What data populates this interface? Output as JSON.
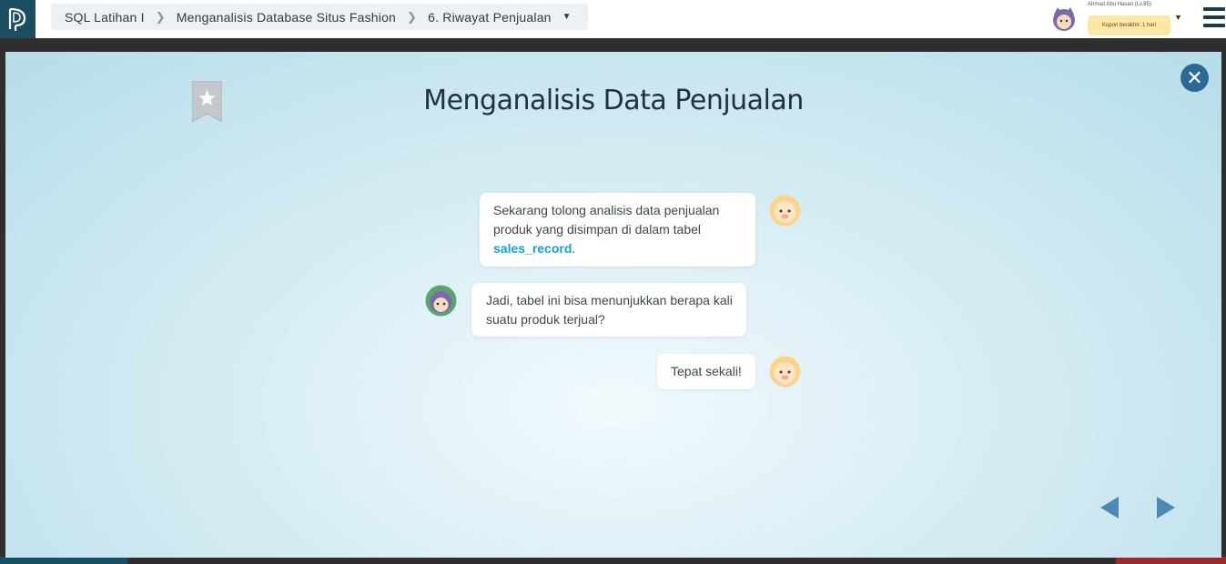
{
  "breadcrumb": {
    "course": "SQL Latihan I",
    "chapter": "Menganalisis Database Situs Fashion",
    "lesson": "6. Riwayat Penjualan"
  },
  "user": {
    "name": "Ahmad Abu Hasan (Lv.85)",
    "coupon": "Kupon berakhir: 1 hari"
  },
  "modal": {
    "title": "Menganalisis Data Penjualan",
    "messages": [
      {
        "speaker": "mentor",
        "line1": "Sekarang tolong analisis data penjualan",
        "line2": "produk yang disimpan di dalam tabel",
        "highlight": "sales_record",
        "suffix": "."
      },
      {
        "speaker": "student",
        "line1": "Jadi, tabel ini bisa menunjukkan berapa kali",
        "line2": "suatu produk terjual?"
      },
      {
        "speaker": "mentor",
        "line1": "Tepat sekali!"
      }
    ]
  },
  "colors": {
    "brand_dark": "#1c4e63",
    "highlight": "#12a2d6",
    "nav_arrow": "#4a8ab5",
    "close_button": "#2b6a95"
  },
  "icons": {
    "close": "close-icon",
    "bookmark": "bookmark-icon",
    "prev": "arrow-left-icon",
    "next": "arrow-right-icon"
  }
}
